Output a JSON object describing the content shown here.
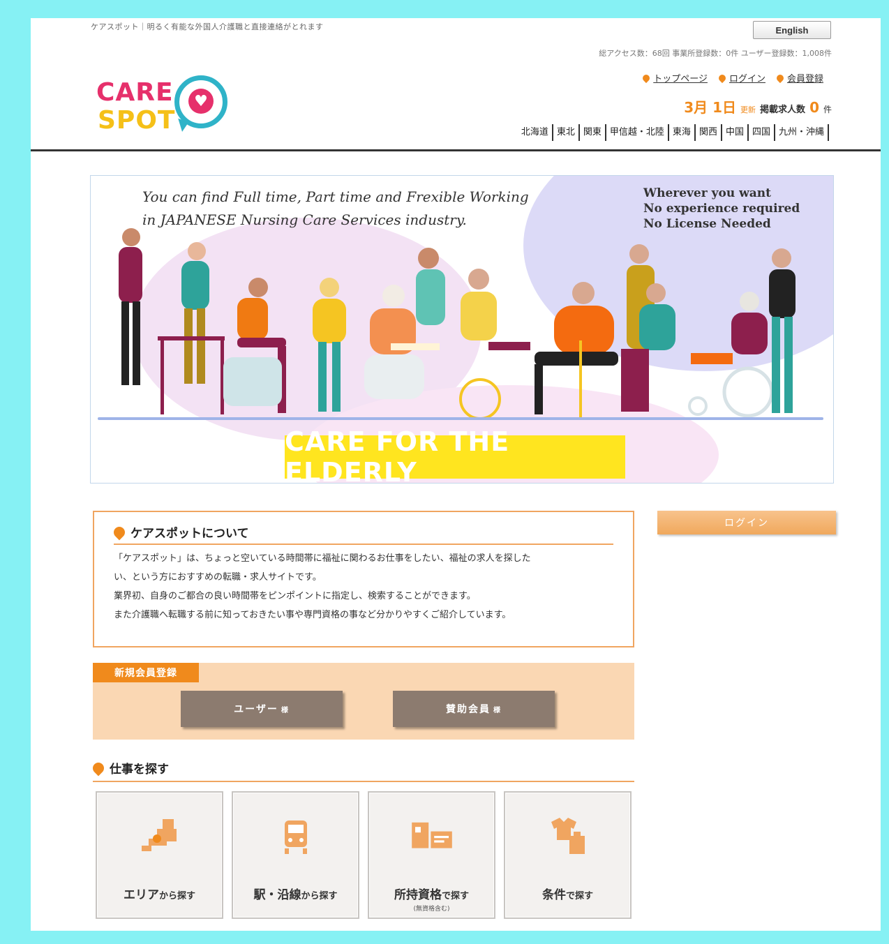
{
  "header": {
    "tagline": "ケアスポット｜明るく有能な外国人介護職と直接連絡がとれます",
    "english_button": "English",
    "stats": "総アクセス数：68回 事業所登録数：0件 ユーザー登録数：1,008件",
    "logo": {
      "line1": "CARE",
      "line2": "SPOT"
    },
    "nav": [
      {
        "label": "トップページ"
      },
      {
        "label": "ログイン"
      },
      {
        "label": "会員登録"
      }
    ],
    "update": {
      "date": "3月 1日",
      "updated": "更新",
      "count_label": "掲載求人数",
      "count": "0",
      "unit": "件"
    },
    "regions": [
      "北海道",
      "東北",
      "関東",
      "甲信越・北陸",
      "東海",
      "関西",
      "中国",
      "四国",
      "九州・沖縄"
    ]
  },
  "hero": {
    "left_text_1": "You can find Full time, Part time and Frexible Working",
    "left_text_2": "in JAPANESE Nursing Care Services industry.",
    "right_text_1": "Wherever you want",
    "right_text_2": "No experience required",
    "right_text_3": "No License Needed",
    "label": "CARE FOR THE ELDERLY"
  },
  "about": {
    "title": "ケアスポットについて",
    "line1": "「ケアスポット」は、ちょっと空いている時間帯に福祉に関わるお仕事をしたい、福祉の求人を探した",
    "line2": "い、という方におすすめの転職・求人サイトです。",
    "line3": "業界初、自身のご都合の良い時間帯をピンポイントに指定し、検索することができます。",
    "line4": "また介護職へ転職する前に知っておきたい事や専門資格の事など分かりやすくご紹介しています。"
  },
  "sidebar": {
    "login_label": "ログイン"
  },
  "registration": {
    "tag": "新規会員登録",
    "user_button": "ユーザー",
    "user_suffix": "様",
    "sponsor_button": "賛助会員",
    "sponsor_suffix": "様"
  },
  "job_search": {
    "title": "仕事を探す",
    "cards": [
      {
        "main": "エリア",
        "suffix": "から探す",
        "sub": "",
        "icon": "map-icon"
      },
      {
        "main": "駅・沿線",
        "suffix": "から探す",
        "sub": "",
        "icon": "train-icon"
      },
      {
        "main": "所持資格",
        "suffix": "で探す",
        "sub": "(無資格含む)",
        "icon": "license-icon"
      },
      {
        "main": "条件",
        "suffix": "で探す",
        "sub": "",
        "icon": "clothes-icon"
      }
    ]
  },
  "colors": {
    "accent": "#f08a1c",
    "brand_pink": "#e6306b",
    "brand_yellow": "#f5c018",
    "brand_teal": "#2fb3c8",
    "background": "#86f1f4"
  }
}
